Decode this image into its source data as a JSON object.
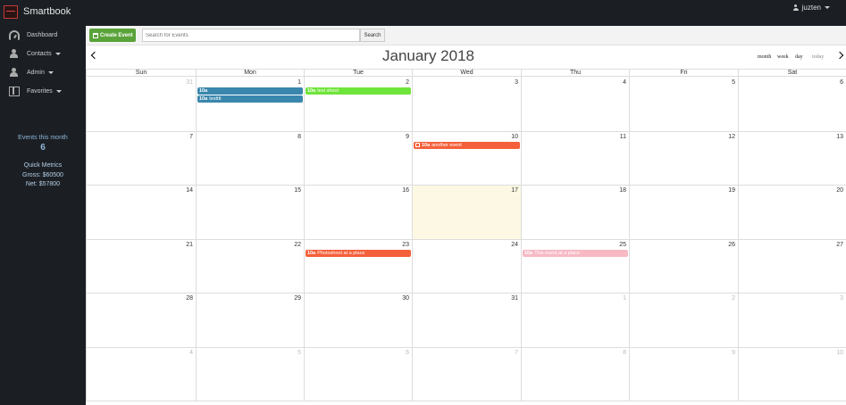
{
  "app": {
    "brand": "Smartbook",
    "user": "juzten"
  },
  "sidebar": {
    "items": [
      {
        "label": "Dashboard",
        "icon": "dashboard-icon",
        "has_caret": false
      },
      {
        "label": "Contacts",
        "icon": "contacts-icon",
        "has_caret": true
      },
      {
        "label": "Admin",
        "icon": "admin-icon",
        "has_caret": true
      },
      {
        "label": "Favorites",
        "icon": "favorites-icon",
        "has_caret": true
      }
    ],
    "events_label": "Events this month",
    "events_count": "6",
    "metrics_title": "Quick Metrics",
    "gross": "Gross: $60500",
    "net": "Net: $57800"
  },
  "toolbar": {
    "create_label": "Create Event",
    "search_placeholder": "Search for Events",
    "search_label": "Search"
  },
  "calendar": {
    "title": "January 2018",
    "views": [
      "month",
      "week",
      "day",
      "today"
    ],
    "days_of_week": [
      "Sun",
      "Mon",
      "Tue",
      "Wed",
      "Thu",
      "Fri",
      "Sat"
    ],
    "weeks": [
      [
        {
          "n": "31",
          "o": true
        },
        {
          "n": "1"
        },
        {
          "n": "2"
        },
        {
          "n": "3"
        },
        {
          "n": "4"
        },
        {
          "n": "5"
        },
        {
          "n": "6"
        }
      ],
      [
        {
          "n": "7"
        },
        {
          "n": "8"
        },
        {
          "n": "9"
        },
        {
          "n": "10"
        },
        {
          "n": "11"
        },
        {
          "n": "12"
        },
        {
          "n": "13"
        }
      ],
      [
        {
          "n": "14"
        },
        {
          "n": "15"
        },
        {
          "n": "16"
        },
        {
          "n": "17",
          "today": true
        },
        {
          "n": "18"
        },
        {
          "n": "19"
        },
        {
          "n": "20"
        }
      ],
      [
        {
          "n": "21"
        },
        {
          "n": "22"
        },
        {
          "n": "23"
        },
        {
          "n": "24"
        },
        {
          "n": "25"
        },
        {
          "n": "26"
        },
        {
          "n": "27"
        }
      ],
      [
        {
          "n": "28"
        },
        {
          "n": "29"
        },
        {
          "n": "30"
        },
        {
          "n": "31"
        },
        {
          "n": "1",
          "o": true
        },
        {
          "n": "2",
          "o": true
        },
        {
          "n": "3",
          "o": true
        }
      ],
      [
        {
          "n": "4",
          "o": true
        },
        {
          "n": "5",
          "o": true
        },
        {
          "n": "6",
          "o": true
        },
        {
          "n": "7",
          "o": true
        },
        {
          "n": "8",
          "o": true
        },
        {
          "n": "9",
          "o": true
        },
        {
          "n": "10",
          "o": true
        }
      ]
    ],
    "events": [
      {
        "week": 0,
        "day": 1,
        "slot": 0,
        "time": "10a",
        "title": "",
        "color": "#3a87ad",
        "check": false
      },
      {
        "week": 0,
        "day": 1,
        "slot": 1,
        "time": "10a",
        "title": "testttt",
        "color": "#3a87ad",
        "check": false
      },
      {
        "week": 0,
        "day": 2,
        "slot": 0,
        "time": "10a",
        "title": "test shoot",
        "color": "#6fe43a",
        "check": false
      },
      {
        "week": 1,
        "day": 3,
        "slot": 0,
        "time": "10a",
        "title": "another event",
        "color": "#f4603a",
        "check": true
      },
      {
        "week": 3,
        "day": 2,
        "slot": 0,
        "time": "10a",
        "title": "Photoshoot at a place",
        "color": "#f4603a",
        "check": false
      },
      {
        "week": 3,
        "day": 4,
        "slot": 0,
        "time": "10a",
        "title": "This event at a place",
        "color": "#f7b9c4",
        "check": false
      }
    ]
  }
}
